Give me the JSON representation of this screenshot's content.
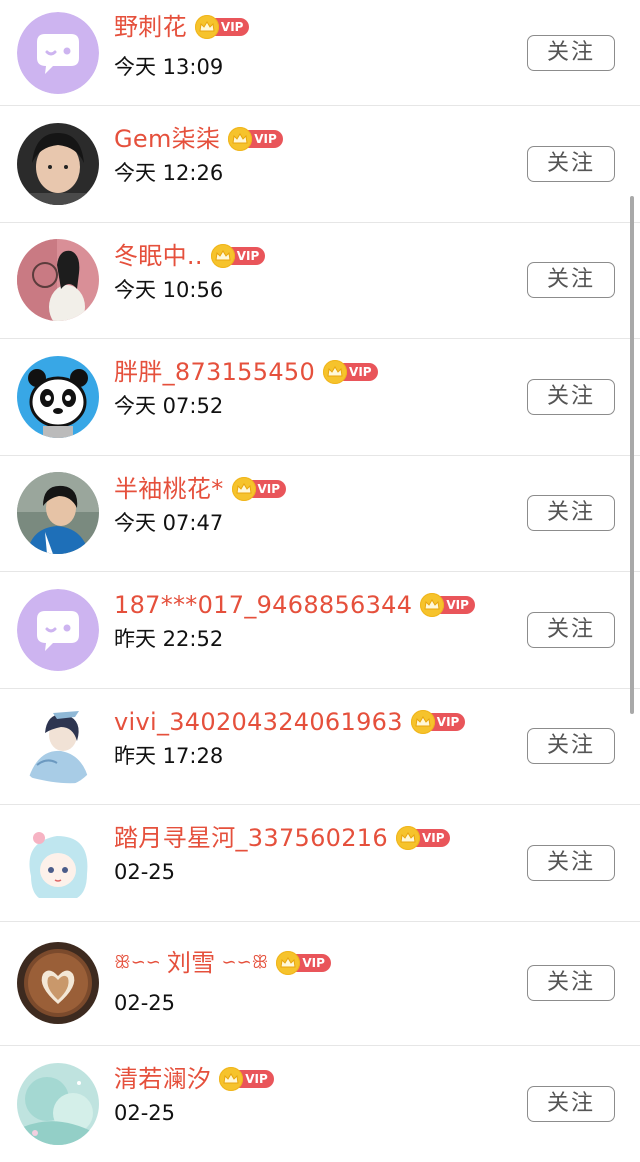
{
  "follow_label": "关注",
  "vip_label": "VIP",
  "colors": {
    "name": "#e5503c",
    "vip_tag": "#e9555a",
    "crown": "#f6c32c"
  },
  "users": [
    {
      "name": "野刺花",
      "time": "今天 13:09",
      "avatar": "default-chat-avatar"
    },
    {
      "name": "Gem柒柒",
      "time": "今天 12:26",
      "avatar": "photo-avatar"
    },
    {
      "name": "冬眠中..",
      "time": "今天 10:56",
      "avatar": "photo-avatar"
    },
    {
      "name": "胖胖_873155450",
      "time": "今天 07:52",
      "avatar": "panda-avatar"
    },
    {
      "name": "半袖桃花*",
      "time": "今天 07:47",
      "avatar": "photo-avatar"
    },
    {
      "name": "187***017_9468856344",
      "time": "昨天 22:52",
      "avatar": "default-chat-avatar"
    },
    {
      "name": "vivi_340204324061963",
      "time": "昨天 17:28",
      "avatar": "illustration-avatar"
    },
    {
      "name": "踏月寻星河_337560216",
      "time": "02-25",
      "avatar": "illustration-avatar"
    },
    {
      "name": "刘雪",
      "time": "02-25",
      "avatar": "latte-art-avatar"
    },
    {
      "name": "清若澜汐",
      "time": "02-25",
      "avatar": "watercolor-avatar"
    }
  ]
}
